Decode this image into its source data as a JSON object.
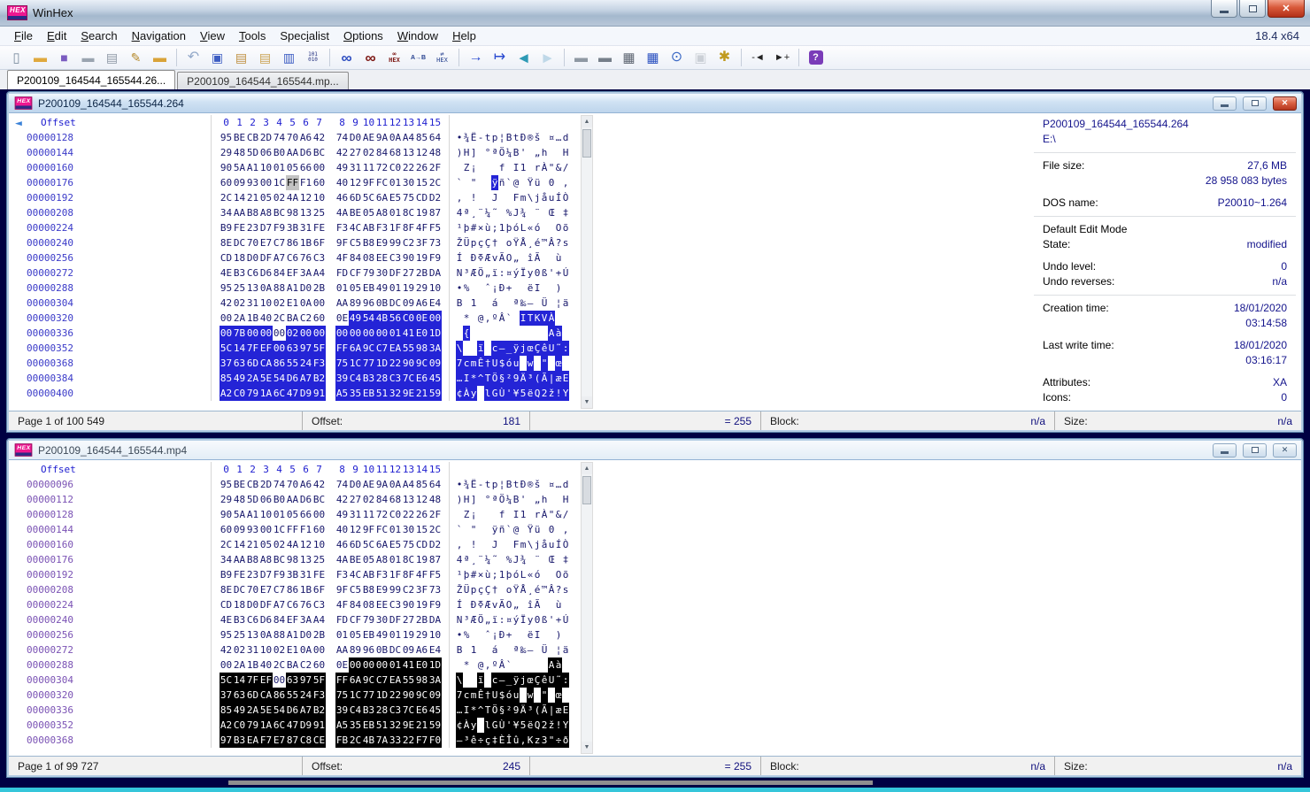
{
  "app": {
    "title": "WinHex",
    "version": "18.4 x64",
    "logo": "HEX"
  },
  "menu": {
    "items": [
      {
        "label": "File",
        "accel": 0
      },
      {
        "label": "Edit",
        "accel": 0
      },
      {
        "label": "Search",
        "accel": 0
      },
      {
        "label": "Navigation",
        "accel": 0
      },
      {
        "label": "View",
        "accel": 0
      },
      {
        "label": "Tools",
        "accel": 0
      },
      {
        "label": "Specialist",
        "accel": 4
      },
      {
        "label": "Options",
        "accel": 0
      },
      {
        "label": "Window",
        "accel": 0
      },
      {
        "label": "Help",
        "accel": 0
      }
    ]
  },
  "toolbar": {
    "groups": [
      [
        {
          "name": "new-file-button",
          "glyph": "▯",
          "color": "#7d8ea0",
          "fs": 15
        },
        {
          "name": "open-file-button",
          "glyph": "▬",
          "color": "#e0a93e",
          "fs": 15
        },
        {
          "name": "save-button",
          "glyph": "■",
          "color": "#7b5cc0",
          "fs": 14
        },
        {
          "name": "save-as-button",
          "glyph": "▬",
          "color": "#9aa4b0",
          "fs": 14
        },
        {
          "name": "print-button",
          "glyph": "▤",
          "color": "#8d97a4",
          "fs": 14
        },
        {
          "name": "properties-button",
          "glyph": "✎",
          "color": "#b5892b",
          "fs": 14
        },
        {
          "name": "open-folder-button",
          "glyph": "▬",
          "color": "#d9a339",
          "fs": 15
        }
      ],
      [
        {
          "name": "undo-button",
          "glyph": "↶",
          "color": "#93a9c9",
          "fs": 16
        },
        {
          "name": "copy-button",
          "glyph": "▣",
          "color": "#3c5cc2",
          "fs": 14
        },
        {
          "name": "paste-write-button",
          "glyph": "▤",
          "color": "#bf8f3f",
          "fs": 14
        },
        {
          "name": "paste-button",
          "glyph": "▤",
          "color": "#caa14f",
          "fs": 14
        },
        {
          "name": "copy-block-button",
          "glyph": "▥",
          "color": "#3c5cc2",
          "fs": 14
        },
        {
          "name": "binary-values-button",
          "glyph": "101\n010",
          "color": "#23307f",
          "fs": 6,
          "mono": true
        }
      ],
      [
        {
          "name": "find-text-button",
          "glyph": "∞",
          "color": "#2b4bbf",
          "fs": 17,
          "bold": true
        },
        {
          "name": "find-hex-button",
          "glyph": "∞",
          "color": "#7c1612",
          "fs": 17,
          "bold": true
        },
        {
          "name": "find-hex-values-button",
          "glyph": "∞\nHEX",
          "color": "#7c1612",
          "fs": 7,
          "mono": true,
          "bold": true
        },
        {
          "name": "replace-text-button",
          "glyph": "A→B",
          "color": "#26418f",
          "fs": 7,
          "bold": true
        },
        {
          "name": "replace-hex-button",
          "glyph": "⇄\nHEX",
          "color": "#26418f",
          "fs": 7,
          "mono": true
        }
      ],
      [
        {
          "name": "go-to-offset-button",
          "glyph": "→",
          "color": "#2b4bd0",
          "fs": 16
        },
        {
          "name": "go-to-page-button",
          "glyph": "↦",
          "color": "#2b4bd0",
          "fs": 16
        },
        {
          "name": "back-button",
          "glyph": "◄",
          "color": "#2e9ab5",
          "fs": 17
        },
        {
          "name": "forward-button",
          "glyph": "►",
          "color": "#bfd8e8",
          "fs": 17
        }
      ],
      [
        {
          "name": "open-disk-button",
          "glyph": "▬",
          "color": "#8f98a3",
          "fs": 15
        },
        {
          "name": "clone-disk-button",
          "glyph": "▬",
          "color": "#767f8a",
          "fs": 15
        },
        {
          "name": "ram-editor-button",
          "glyph": "▦",
          "color": "#5c6470",
          "fs": 15
        },
        {
          "name": "calculator-button",
          "glyph": "▦",
          "color": "#2a50c0",
          "fs": 15
        },
        {
          "name": "analyze-button",
          "glyph": "⊙",
          "color": "#3a68c4",
          "fs": 16
        },
        {
          "name": "gallery-button",
          "glyph": "▣",
          "color": "#9aa2ab",
          "fs": 15,
          "disabled": true
        },
        {
          "name": "options-gear-button",
          "glyph": "✱",
          "color": "#c09a1e",
          "fs": 16
        }
      ],
      [
        {
          "name": "previous-position-button",
          "glyph": "-◄",
          "color": "#222222",
          "fs": 11
        },
        {
          "name": "next-position-button",
          "glyph": "►+",
          "color": "#222222",
          "fs": 11
        }
      ],
      [
        {
          "name": "help-button",
          "glyph": "?",
          "color": "#ffffff",
          "fs": 11,
          "round": true,
          "bold": true
        }
      ]
    ]
  },
  "tabs": [
    {
      "label": "P200109_164544_165544.26...",
      "active": true
    },
    {
      "label": "P200109_164544_165544.mp...",
      "active": false
    }
  ],
  "colors": {
    "selection_active": "#2424d6",
    "selection_inactive": "#000000",
    "cursor": "#c3c3c3",
    "offset_active": "#3a3ac8",
    "offset_inactive": "#7a52b4",
    "hex_text": "#17176b",
    "mdi_background": "#000042"
  },
  "windows": [
    {
      "title": "P200109_164544_165544.264",
      "active": true,
      "header": {
        "offset_label": "Offset",
        "back_arrow": "◄",
        "cols": [
          "0",
          "1",
          "2",
          "3",
          "4",
          "5",
          "6",
          "7",
          "8",
          "9",
          "10",
          "11",
          "12",
          "13",
          "14",
          "15"
        ]
      },
      "rows": [
        {
          "o": "00000128",
          "h": "95 BE CB 2D 74 70 A6 42 74 D0 AE 9A 0A A4 85 64",
          "t": "•¾Ë-tp¦BtÐ®š ¤…d"
        },
        {
          "o": "00000144",
          "h": "29 48 5D 06 B0 AA D6 BC 42 27 02 84 68 13 12 48",
          "t": ")H] °ªÖ¼B' „h  H"
        },
        {
          "o": "00000160",
          "h": "90 5A A1 10 01 05 66 00 49 31 11 72 C0 22 26 2F",
          "t": " Z¡   f I1 rÀ\"&/"
        },
        {
          "o": "00000176",
          "h": "60 09 93 00 1C FF F1 60 40 12 9F FC 01 30 15 2C",
          "t": "` \"  ÿñ`@ Ÿü 0 ,",
          "c": 5,
          "ct": 5
        },
        {
          "o": "00000192",
          "h": "2C 14 21 05 02 4A 12 10 46 6D 5C 6A E5 75 CD D2",
          "t": ", !  J  Fm\\jåuÍÒ"
        },
        {
          "o": "00000208",
          "h": "34 AA B8 A8 BC 98 13 25 4A BE 05 A8 01 8C 19 87",
          "t": "4ª¸¨¼˜ %J¾ ¨ Œ ‡"
        },
        {
          "o": "00000224",
          "h": "B9 FE 23 D7 F9 3B 31 FE F3 4C AB F3 1F 8F 4F F5",
          "t": "¹þ#×ù;1þóL«ó  Oõ"
        },
        {
          "o": "00000240",
          "h": "8E DC 70 E7 C7 86 1B 6F 9F C5 B8 E9 99 C2 3F 73",
          "t": "ŽÜpçÇ† oŸÅ¸é™Â?s"
        },
        {
          "o": "00000256",
          "h": "CD 18 D0 DF A7 C6 76 C3 4F 84 08 EE C3 90 19 F9",
          "t": "Í ÐߧÆvÃO„ îÃ  ù"
        },
        {
          "o": "00000272",
          "h": "4E B3 C6 D6 84 EF 3A A4 FD CF 79 30 DF 27 2B DA",
          "t": "N³ÆÖ„ï:¤ýÏy0ß'+Ú"
        },
        {
          "o": "00000288",
          "h": "95 25 13 0A 88 A1 D0 2B 01 05 EB 49 01 19 29 10",
          "t": "•%  ˆ¡Ð+  ëI  ) "
        },
        {
          "o": "00000304",
          "h": "42 02 31 10 02 E1 0A 00 AA 89 96 0B DC 09 A6 E4",
          "t": "B 1  á  ª‰– Ü ¦ä"
        },
        {
          "o": "00000320",
          "h": "00 2A 1B 40 2C BA C2 60 0E 49 54 4B 56 C0 0E 00",
          "t": " * @,ºÂ` ITKVÀ  ",
          "s": [
            [
              9,
              15
            ]
          ]
        },
        {
          "o": "00000336",
          "h": "00 7B 00 00 00 02 00 00 00 00 00 00 01 41 E0 1D",
          "t": " {           Aà ",
          "s": [
            [
              0,
              3
            ],
            [
              5,
              15
            ]
          ]
        },
        {
          "o": "00000352",
          "h": "5C 14 7F EF 00 63 97 5F FF 6A 9C C7 EA 55 98 3A",
          "t": "\\  ï c—_ÿjœÇêU˜:",
          "s": [
            [
              0,
              15
            ]
          ]
        },
        {
          "o": "00000368",
          "h": "37 63 6D CA 86 55 24 F3 75 1C 77 1D 22 90 9C 09",
          "t": "7cmÊ†U$óu w \" œ ",
          "s": [
            [
              0,
              15
            ]
          ]
        },
        {
          "o": "00000384",
          "h": "85 49 2A 5E 54 D6 A7 B2 39 C4 B3 28 C3 7C E6 45",
          "t": "…I*^TÖ§²9Ä³(Ã|æE",
          "s": [
            [
              0,
              15
            ]
          ]
        },
        {
          "o": "00000400",
          "h": "A2 C0 79 1A 6C 47 D9 91 A5 35 EB 51 32 9E 21 59",
          "t": "¢Ày lGÙ'¥5ëQ2ž!Y",
          "s": [
            [
              0,
              15
            ]
          ]
        }
      ],
      "status": {
        "page": "Page 1 of 100 549",
        "offset_label": "Offset:",
        "offset_value": "181",
        "equals_value": "= 255",
        "block_label": "Block:",
        "block_value": "n/a",
        "size_label": "Size:",
        "size_value": "n/a"
      },
      "info": {
        "title": "P200109_164544_165544.264",
        "path": "E:\\",
        "groups": [
          {
            "rows": [
              {
                "l": "File size:",
                "v": "27,6 MB"
              },
              {
                "l": "",
                "v": "28 958 083 bytes"
              },
              {
                "gap": true
              },
              {
                "l": "DOS name:",
                "v": "P20010~1.264"
              }
            ]
          },
          {
            "rows": [
              {
                "head": "Default Edit Mode"
              },
              {
                "l": "State:",
                "v": "modified"
              },
              {
                "gap": true
              },
              {
                "l": "Undo level:",
                "v": "0"
              },
              {
                "l": "Undo reverses:",
                "v": "n/a"
              }
            ]
          },
          {
            "rows": [
              {
                "l": "Creation time:",
                "v": "18/01/2020"
              },
              {
                "l": "",
                "v": "03:14:58"
              },
              {
                "gap": true
              },
              {
                "l": "Last write time:",
                "v": "18/01/2020"
              },
              {
                "l": "",
                "v": "03:16:17"
              },
              {
                "gap": true
              },
              {
                "l": "Attributes:",
                "v": "XA"
              },
              {
                "l": "Icons:",
                "v": "0"
              }
            ]
          }
        ]
      }
    },
    {
      "title": "P200109_164544_165544.mp4",
      "active": false,
      "header": {
        "offset_label": "Offset",
        "back_arrow": "",
        "cols": [
          "0",
          "1",
          "2",
          "3",
          "4",
          "5",
          "6",
          "7",
          "8",
          "9",
          "10",
          "11",
          "12",
          "13",
          "14",
          "15"
        ]
      },
      "rows": [
        {
          "o": "00000096",
          "h": "95 BE CB 2D 74 70 A6 42 74 D0 AE 9A 0A A4 85 64",
          "t": "•¾Ë-tp¦BtÐ®š ¤…d"
        },
        {
          "o": "00000112",
          "h": "29 48 5D 06 B0 AA D6 BC 42 27 02 84 68 13 12 48",
          "t": ")H] °ªÖ¼B' „h  H"
        },
        {
          "o": "00000128",
          "h": "90 5A A1 10 01 05 66 00 49 31 11 72 C0 22 26 2F",
          "t": " Z¡   f I1 rÀ\"&/"
        },
        {
          "o": "00000144",
          "h": "60 09 93 00 1C FF F1 60 40 12 9F FC 01 30 15 2C",
          "t": "` \"  ÿñ`@ Ÿü 0 ,"
        },
        {
          "o": "00000160",
          "h": "2C 14 21 05 02 4A 12 10 46 6D 5C 6A E5 75 CD D2",
          "t": ", !  J  Fm\\jåuÍÒ"
        },
        {
          "o": "00000176",
          "h": "34 AA B8 A8 BC 98 13 25 4A BE 05 A8 01 8C 19 87",
          "t": "4ª¸¨¼˜ %J¾ ¨ Œ ‡"
        },
        {
          "o": "00000192",
          "h": "B9 FE 23 D7 F9 3B 31 FE F3 4C AB F3 1F 8F 4F F5",
          "t": "¹þ#×ù;1þóL«ó  Oõ"
        },
        {
          "o": "00000208",
          "h": "8E DC 70 E7 C7 86 1B 6F 9F C5 B8 E9 99 C2 3F 73",
          "t": "ŽÜpçÇ† oŸÅ¸é™Â?s"
        },
        {
          "o": "00000224",
          "h": "CD 18 D0 DF A7 C6 76 C3 4F 84 08 EE C3 90 19 F9",
          "t": "Í ÐߧÆvÃO„ îÃ  ù"
        },
        {
          "o": "00000240",
          "h": "4E B3 C6 D6 84 EF 3A A4 FD CF 79 30 DF 27 2B DA",
          "t": "N³ÆÖ„ï:¤ýÏy0ß'+Ú"
        },
        {
          "o": "00000256",
          "h": "95 25 13 0A 88 A1 D0 2B 01 05 EB 49 01 19 29 10",
          "t": "•%  ˆ¡Ð+  ëI  ) "
        },
        {
          "o": "00000272",
          "h": "42 02 31 10 02 E1 0A 00 AA 89 96 0B DC 09 A6 E4",
          "t": "B 1  á  ª‰– Ü ¦ä"
        },
        {
          "o": "00000288",
          "h": "00 2A 1B 40 2C BA C2 60 0E 00 00 00 01 41 E0 1D",
          "t": " * @,ºÂ`     Aà ",
          "s": [
            [
              9,
              15
            ]
          ]
        },
        {
          "o": "00000304",
          "h": "5C 14 7F EF 00 63 97 5F FF 6A 9C C7 EA 55 98 3A",
          "t": "\\  ï c—_ÿjœÇêU˜:",
          "s": [
            [
              0,
              3
            ],
            [
              5,
              15
            ]
          ]
        },
        {
          "o": "00000320",
          "h": "37 63 6D CA 86 55 24 F3 75 1C 77 1D 22 90 9C 09",
          "t": "7cmÊ†U$óu w \" œ ",
          "s": [
            [
              0,
              15
            ]
          ]
        },
        {
          "o": "00000336",
          "h": "85 49 2A 5E 54 D6 A7 B2 39 C4 B3 28 C3 7C E6 45",
          "t": "…I*^TÖ§²9Ä³(Ã|æE",
          "s": [
            [
              0,
              15
            ]
          ]
        },
        {
          "o": "00000352",
          "h": "A2 C0 79 1A 6C 47 D9 91 A5 35 EB 51 32 9E 21 59",
          "t": "¢Ày lGÙ'¥5ëQ2ž!Y",
          "s": [
            [
              0,
              15
            ]
          ]
        },
        {
          "o": "00000368",
          "h": "97 B3 EA F7 E7 87 C8 CE FB 2C 4B 7A 33 22 F7 F0",
          "t": "—³ê÷ç‡ÈÎû,Kz3\"÷ð",
          "s": [
            [
              0,
              15
            ]
          ]
        }
      ],
      "status": {
        "page": "Page 1 of 99 727",
        "offset_label": "Offset:",
        "offset_value": "245",
        "equals_value": "= 255",
        "block_label": "Block:",
        "block_value": "n/a",
        "size_label": "Size:",
        "size_value": "n/a"
      }
    }
  ]
}
